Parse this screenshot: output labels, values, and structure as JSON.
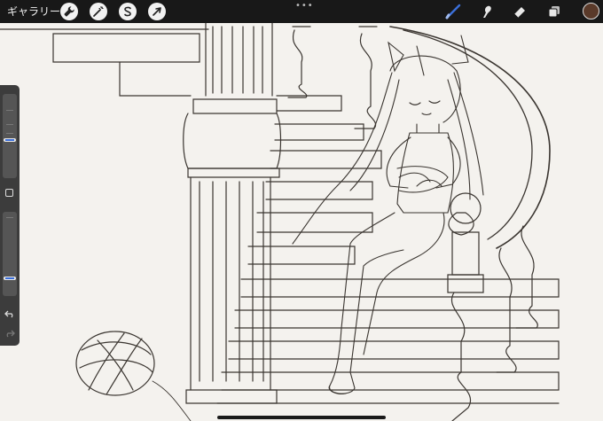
{
  "topbar": {
    "gallery_label": "ギャラリー",
    "left_tools": [
      {
        "name": "actions",
        "icon": "wrench-icon"
      },
      {
        "name": "adjustments",
        "icon": "magic-wand-icon"
      },
      {
        "name": "selection",
        "icon": "selection-s-icon"
      },
      {
        "name": "transform",
        "icon": "arrow-cursor-icon"
      }
    ],
    "right_tools": [
      {
        "name": "brush",
        "icon": "brush-icon",
        "active": true
      },
      {
        "name": "smudge",
        "icon": "smudge-finger-icon"
      },
      {
        "name": "eraser",
        "icon": "eraser-icon"
      },
      {
        "name": "layers",
        "icon": "layers-icon"
      }
    ],
    "dots": "•••"
  },
  "colors": {
    "topbar_bg": "#181818",
    "brush_active": "#3b6fd9",
    "current_color": "#5a3a2a",
    "canvas_bg": "#f4f2ee",
    "ink": "#3a3530"
  },
  "sidebar": {
    "brush_size": 0.45,
    "opacity": 0.2
  }
}
